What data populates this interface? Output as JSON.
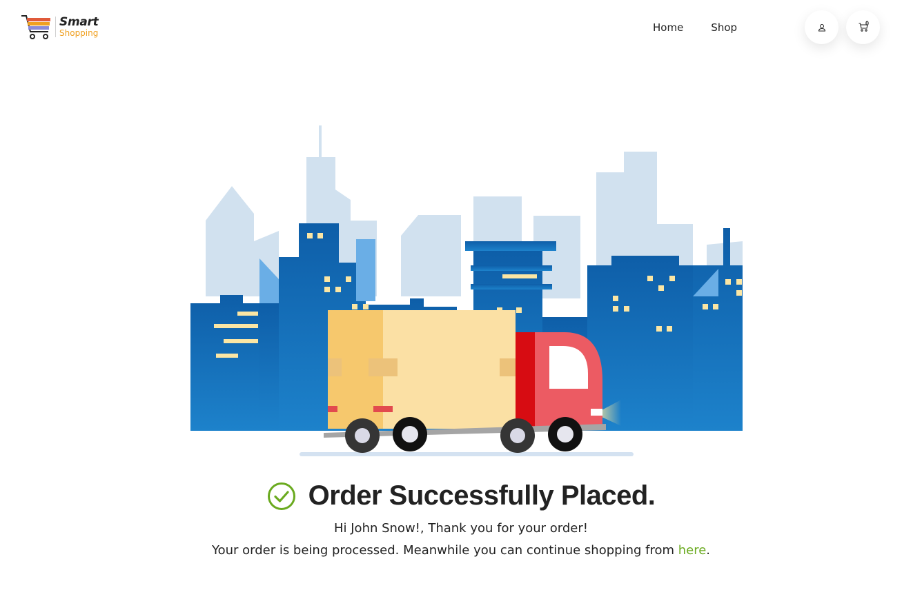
{
  "brand": {
    "name_top": "Smart",
    "name_bottom": "Shopping"
  },
  "nav": {
    "home": "Home",
    "shop": "Shop"
  },
  "header": {
    "user_icon": "user-icon",
    "cart_icon": "cart-icon",
    "cart_count": "0"
  },
  "illustration": "delivery-truck-city-illustration",
  "message": {
    "title": "Order Successfully Placed.",
    "greeting": "Hi John Snow!, Thank you for your order!",
    "processing_text": "Your order is being processed. Meanwhile you can continue shopping from ",
    "link_text": "here",
    "end_punct": "."
  },
  "colors": {
    "accent_green": "#6aaa1f",
    "brand_orange": "#f0a020",
    "sky_blue": "#1a72bd",
    "truck_red": "#e95a61"
  }
}
